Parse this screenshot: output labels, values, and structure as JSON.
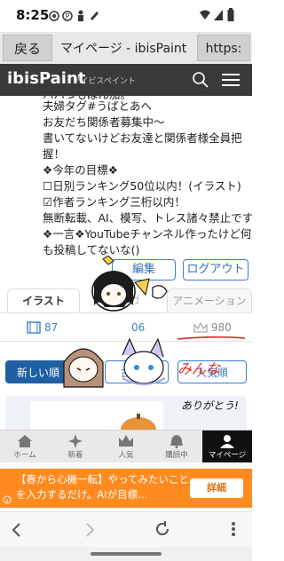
{
  "status_bar": {
    "time": "8:25"
  },
  "browser": {
    "back_label": "戻る",
    "title": "マイページ - ibisPaint",
    "url_label": "https:"
  },
  "app_header": {
    "logo": "ibisPaint",
    "logo_sub": "アイビスペイント"
  },
  "profile": {
    "lines": [
      "ハハつもばん加。",
      "夫婦タグ#うぱとあへ",
      "お友だち関係者募集中～",
      "書いてないけどお友達と関係者様全員把",
      "握！",
      "❖今年の目標❖",
      "☐日別ランキング50位以内！(イラスト)",
      "☑作者ランキング三桁以内！",
      "無断転載、AI、模写、トレス諸々禁止です",
      "❖一言❖YouTubeチャンネル作ったけど何",
      "も投稿してないな()"
    ],
    "edit_label": "編集",
    "logout_label": "ログアウト"
  },
  "tabs": [
    "イラスト",
    "マンガ",
    "アニメーション"
  ],
  "counts": {
    "illustrations": "87",
    "mid": "06",
    "crowns": "980"
  },
  "sort": {
    "new_label": "新しい順",
    "old_label": "古い順",
    "popular_label": "人気順"
  },
  "handwritten": {
    "sign": "ありがとう!",
    "small": "みんな"
  },
  "bottom_nav": [
    {
      "label": "ホーム",
      "icon": "home-icon"
    },
    {
      "label": "新着",
      "icon": "sparkle-icon"
    },
    {
      "label": "人気",
      "icon": "crown-icon"
    },
    {
      "label": "購読中",
      "icon": "bell-icon"
    },
    {
      "label": "マイページ",
      "icon": "person-icon"
    }
  ],
  "ad": {
    "text": "【春から心機一転】やってみたいことを入力するだけ。AIが目標…",
    "button": "詳細"
  },
  "colors": {
    "accent": "#3d7ec7",
    "header": "#3a3a3a",
    "ad": "#ff8a1f",
    "active_nav": "#111111"
  }
}
